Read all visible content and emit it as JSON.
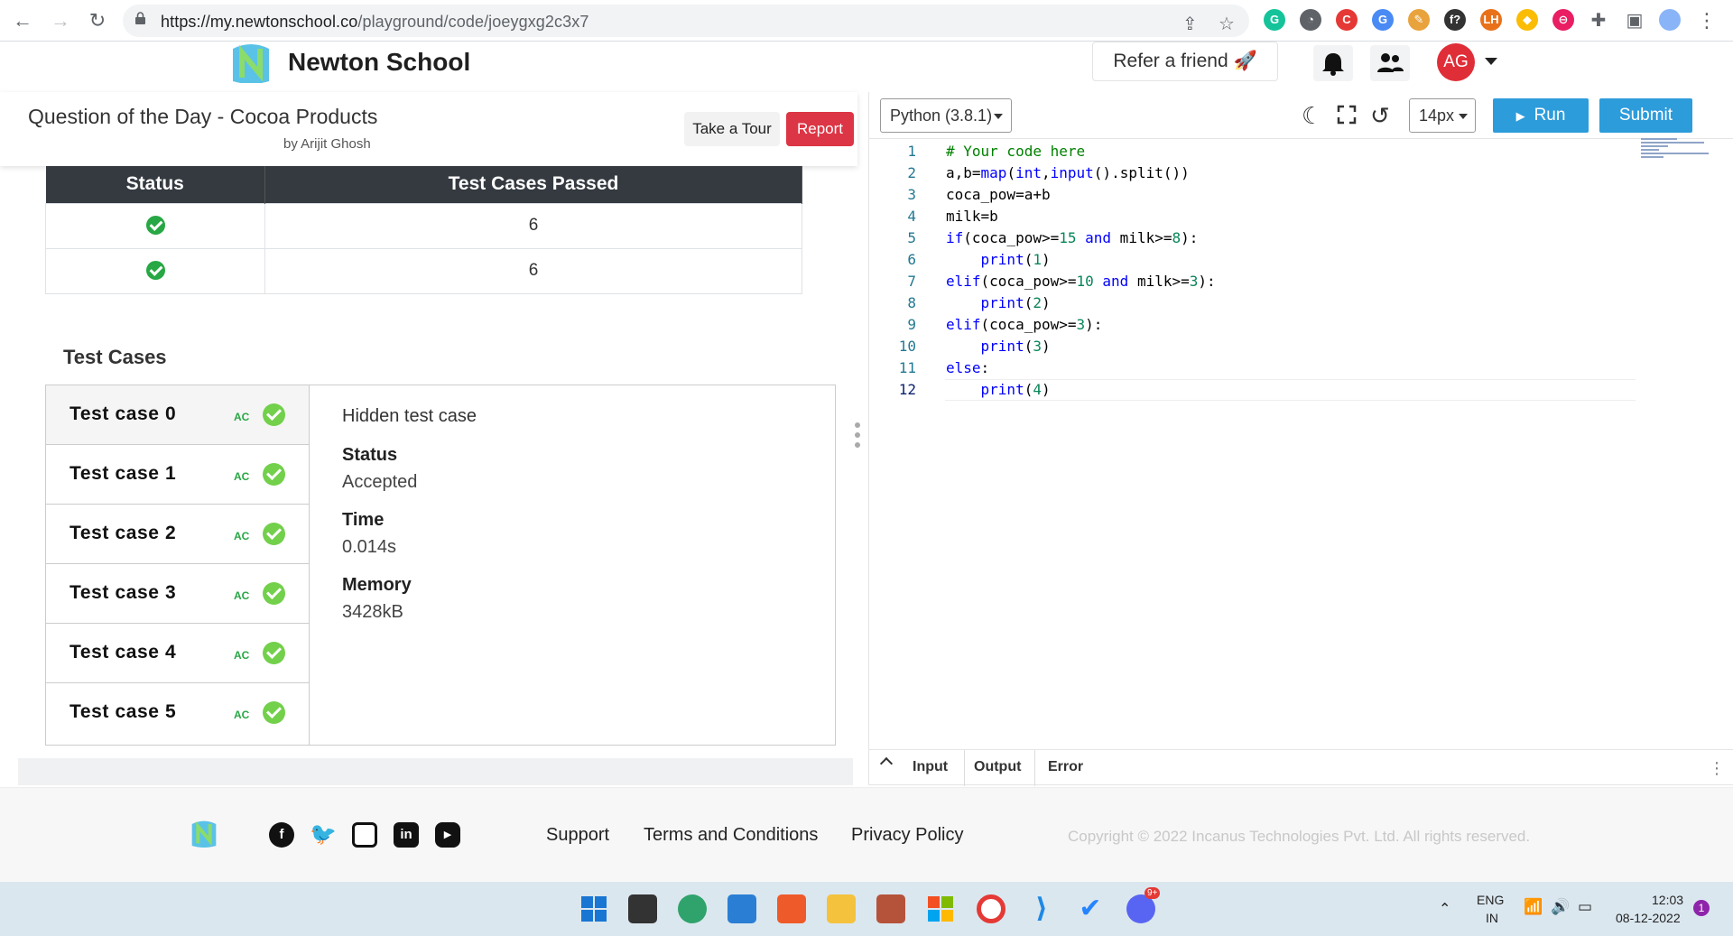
{
  "browser": {
    "url_host": "https://my.newtonschool.co",
    "url_path": "/playground/code/joeygxg2c3x7",
    "extensions": [
      {
        "name": "grammarly-icon",
        "label": "G",
        "color": "#15c39a"
      },
      {
        "name": "speed-icon",
        "label": "◔",
        "color": "#5f6368"
      },
      {
        "name": "adblock-icon",
        "label": "C",
        "color": "#e53935"
      },
      {
        "name": "translate-icon",
        "label": "G",
        "color": "#4a8af4"
      },
      {
        "name": "pen-icon",
        "label": "✎",
        "color": "#e8a33d"
      },
      {
        "name": "formula-icon",
        "label": "f?",
        "color": "#333333"
      },
      {
        "name": "lh-icon",
        "label": "LH",
        "color": "#e8711a"
      },
      {
        "name": "diamond-icon",
        "label": "◆",
        "color": "#fbbc04"
      },
      {
        "name": "toggl-icon",
        "label": "⊖",
        "color": "#e91e63"
      }
    ]
  },
  "header": {
    "brand": "Newton School",
    "refer": "Refer a friend 🚀",
    "avatar": "AG"
  },
  "question": {
    "title": "Question of the Day - Cocoa Products",
    "author": "by Arijit Ghosh",
    "tour_label": "Take a Tour",
    "report_label": "Report"
  },
  "status_table": {
    "headers": [
      "Status",
      "Test Cases Passed"
    ],
    "rows": [
      {
        "status": "passed",
        "passed": "6"
      },
      {
        "status": "passed",
        "passed": "6"
      }
    ]
  },
  "test_cases": {
    "heading": "Test Cases",
    "items": [
      {
        "name": "Test case 0",
        "verdict": "AC"
      },
      {
        "name": "Test case 1",
        "verdict": "AC"
      },
      {
        "name": "Test case 2",
        "verdict": "AC"
      },
      {
        "name": "Test case 3",
        "verdict": "AC"
      },
      {
        "name": "Test case 4",
        "verdict": "AC"
      },
      {
        "name": "Test case 5",
        "verdict": "AC"
      }
    ],
    "selected": {
      "title": "Hidden test case",
      "status_label": "Status",
      "status_value": "Accepted",
      "time_label": "Time",
      "time_value": "0.014s",
      "memory_label": "Memory",
      "memory_value": "3428kB"
    }
  },
  "editor": {
    "language": "Python (3.8.1)",
    "font_size": "14px",
    "run_label": "Run",
    "submit_label": "Submit",
    "lines": [
      "# Your code here",
      "a,b=map(int,input().split())",
      "coca_pow=a+b",
      "milk=b",
      "if(coca_pow>=15 and milk>=8):",
      "    print(1)",
      "elif(coca_pow>=10 and milk>=3):",
      "    print(2)",
      "elif(coca_pow>=3):",
      "    print(3)",
      "else:",
      "    print(4)"
    ],
    "io_tabs": [
      "Input",
      "Output",
      "Error"
    ]
  },
  "footer": {
    "links": [
      "Support",
      "Terms and Conditions",
      "Privacy Policy"
    ],
    "copyright": "Copyright © 2022 Incanus Technologies Pvt. Ltd. All rights reserved."
  },
  "taskbar": {
    "lang_top": "ENG",
    "lang_bottom": "IN",
    "time": "12:03",
    "date": "08-12-2022",
    "notifications": "1",
    "badge": "9+"
  }
}
